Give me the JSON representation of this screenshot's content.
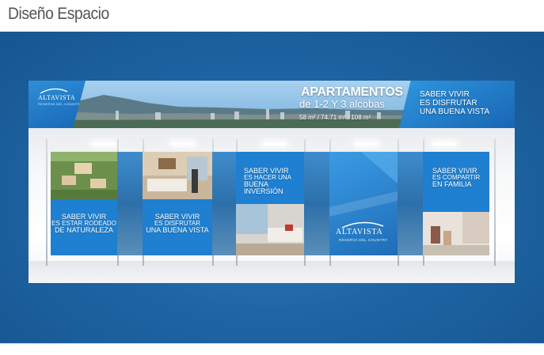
{
  "page": {
    "title": "Diseño Espacio"
  },
  "banner": {
    "logo": {
      "name": "ALTAVISTA",
      "tagline": "RESERVA DEL COUNTRY"
    },
    "heading": "APARTAMENTOS",
    "subheading": "de 1-2 Y 3 alcobas",
    "areas": "58 m² / 74.71 m² / 108 m²",
    "slogan": [
      "SABER VIVIR",
      "ES DISFRUTAR",
      "UNA BUENA VISTA"
    ]
  },
  "panels": [
    {
      "lines": [
        "SABER VIVIR",
        "ES ESTAR RODEADO",
        "DE NATURALEZA"
      ]
    },
    {
      "lines": [
        "SABER VIVIR",
        "ES DISFRUTAR",
        "UNA BUENA VISTA"
      ]
    },
    {
      "lines": [
        "SABER VIVIR",
        "ES HACER UNA",
        "BUENA INVERSIÓN"
      ]
    },
    {
      "logo": {
        "name": "ALTAVISTA",
        "tagline": "RESERVA DEL COUNTRY"
      }
    },
    {
      "lines": [
        "SABER VIVIR",
        "ES COMPARTIR",
        "EN FAMILIA"
      ]
    }
  ],
  "colors": {
    "stage_blue": "#1f66a6",
    "brand_blue": "#1f7fd0",
    "title_gray": "#555555"
  }
}
